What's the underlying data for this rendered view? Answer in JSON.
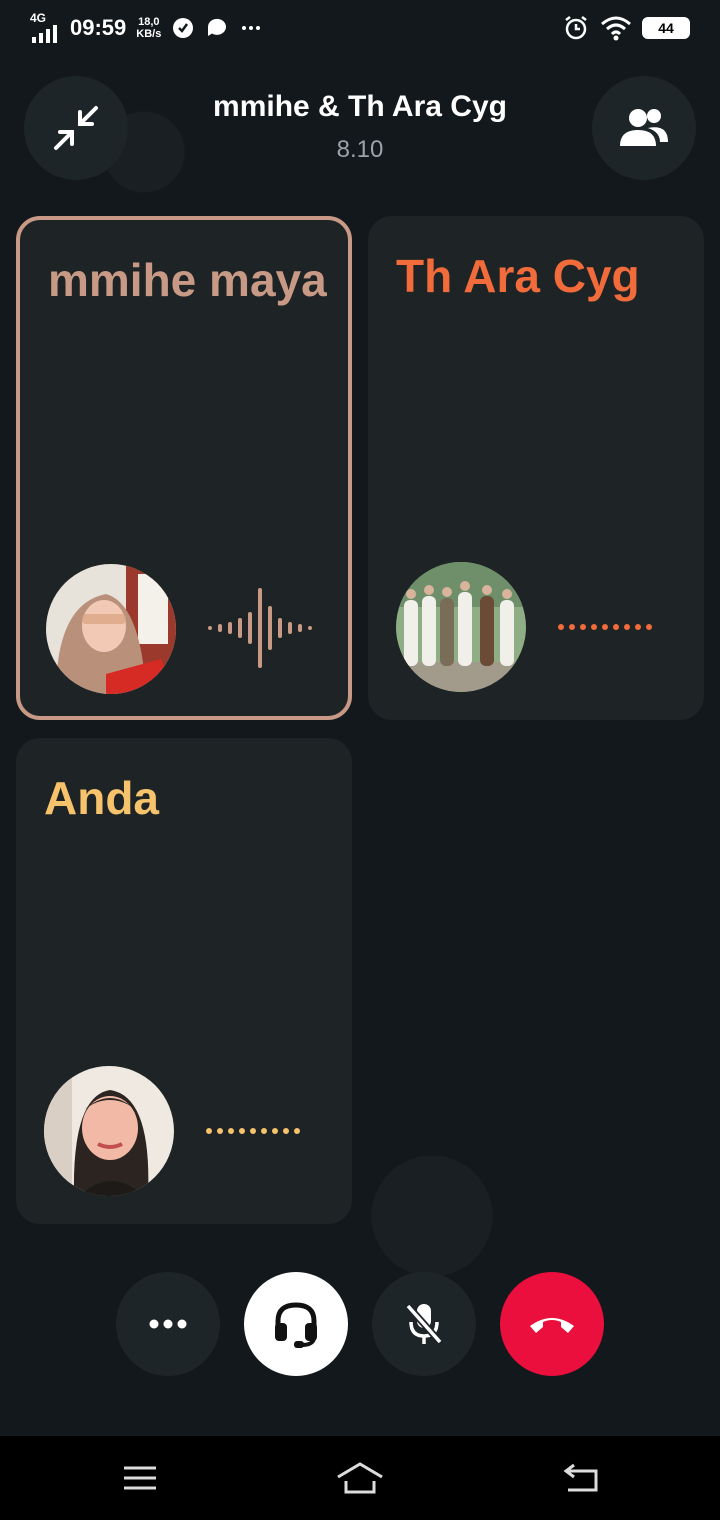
{
  "status_bar": {
    "network": "4G",
    "time": "09:59",
    "speed_value": "18,0",
    "speed_unit": "KB/s",
    "battery": "44",
    "icons": [
      "signal-icon",
      "whatsapp-icon",
      "chat-bubble-icon",
      "more-dots-icon",
      "alarm-icon",
      "wifi-icon",
      "battery-icon"
    ]
  },
  "header": {
    "title": "mmihe & Th Ara Cyg",
    "duration": "8.10",
    "minimize_icon": "minimize-arrows-icon",
    "participants_icon": "participants-icon"
  },
  "participants": [
    {
      "name": "mmihe maya",
      "color": "#c89a85",
      "state": "speaking",
      "active": true
    },
    {
      "name": "Th Ara Cyg",
      "color": "#f26b3a",
      "state": "connecting",
      "active": false
    },
    {
      "name": "Anda",
      "color": "#f6c26b",
      "state": "connecting",
      "active": false
    }
  ],
  "controls": {
    "more_icon": "more-dots-icon",
    "headset_icon": "headset-icon",
    "mute_icon": "mic-off-icon",
    "end_icon": "end-call-icon",
    "colors": {
      "end_call": "#ea0f3d",
      "headset_bg": "#ffffff",
      "button_bg": "#1e2529"
    }
  },
  "nav_bar": {
    "icons": [
      "menu-icon",
      "home-icon",
      "back-icon"
    ]
  }
}
